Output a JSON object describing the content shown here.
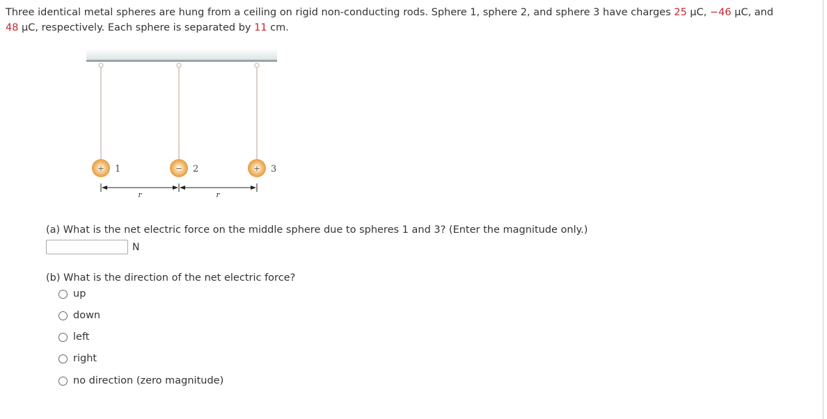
{
  "problem": {
    "text_1": "Three identical metal spheres are hung from a ceiling on rigid non-conducting rods. Sphere 1, sphere 2, and sphere 3 have charges ",
    "q1": "25",
    "unit_1": " μC, ",
    "q2": "−46",
    "unit_2": " μC, and",
    "q3": "48",
    "text_2": " μC, respectively. Each sphere is separated by ",
    "separation": "11",
    "text_3": " cm."
  },
  "figure": {
    "spheres": [
      {
        "label": "1",
        "sign": "+"
      },
      {
        "label": "2",
        "sign": "−"
      },
      {
        "label": "3",
        "sign": "+"
      }
    ],
    "distance_labels": [
      "r",
      "r"
    ],
    "colors": {
      "sphere": "#eaa34a",
      "rod": "#d9cfc9",
      "ceiling": "#9aa3a6"
    }
  },
  "part_a": {
    "question": "(a) What is the net electric force on the middle sphere due to spheres 1 and 3? (Enter the magnitude only.)",
    "input_value": "",
    "unit": "N"
  },
  "part_b": {
    "question": "(b) What is the direction of the net electric force?",
    "options": [
      "up",
      "down",
      "left",
      "right",
      "no direction (zero magnitude)"
    ]
  }
}
